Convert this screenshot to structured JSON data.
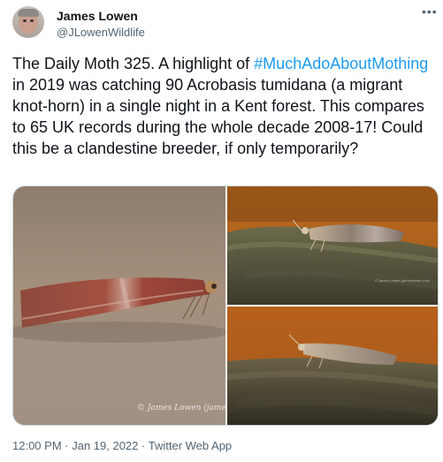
{
  "author": {
    "name": "James Lowen",
    "handle": "@JLowenWildlife"
  },
  "tweet": {
    "text_before": "The Daily Moth 325. A highlight of ",
    "hashtag": "#MuchAdoAboutMothing",
    "text_after": " in 2019 was catching 90 Acrobasis tumidana (a migrant knot-horn) in a single night in a Kent forest. This compares to 65 UK records during the whole decade 2008-17! Could this be a clandestine breeder, if only temporarily?"
  },
  "media": {
    "watermark_1": "© James Lowen (james",
    "watermark_2": "© James Lowen (jameslowen.com)"
  },
  "meta": {
    "time": "12:00 PM",
    "separator_1": " · ",
    "date": "Jan 19, 2022",
    "separator_2": " · ",
    "source": "Twitter Web App"
  },
  "colors": {
    "link": "#1d9bf0",
    "secondary_text": "#536471"
  },
  "icons": {
    "more": "more-options-icon"
  }
}
